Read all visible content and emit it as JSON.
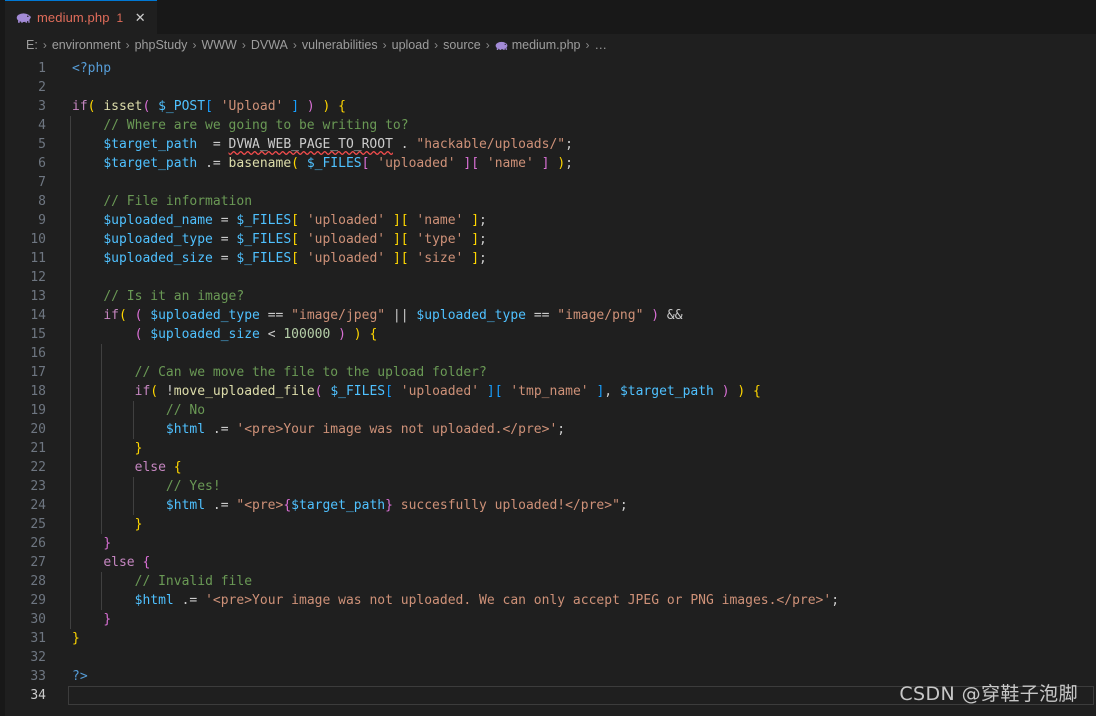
{
  "tab": {
    "filename": "medium.php",
    "badge": "1",
    "close_label": "✕",
    "icon": "php-elephant-icon"
  },
  "breadcrumbs": {
    "separator": "›",
    "overflow": "…",
    "items": [
      {
        "label": "E:"
      },
      {
        "label": "environment"
      },
      {
        "label": "phpStudy"
      },
      {
        "label": "WWW"
      },
      {
        "label": "DVWA"
      },
      {
        "label": "vulnerabilities"
      },
      {
        "label": "upload"
      },
      {
        "label": "source"
      },
      {
        "label": "medium.php",
        "icon": "php-elephant-icon"
      }
    ]
  },
  "editor": {
    "language": "php",
    "active_line": 34,
    "total_lines": 34,
    "line_numbers": [
      1,
      2,
      3,
      4,
      5,
      6,
      7,
      8,
      9,
      10,
      11,
      12,
      13,
      14,
      15,
      16,
      17,
      18,
      19,
      20,
      21,
      22,
      23,
      24,
      25,
      26,
      27,
      28,
      29,
      30,
      31,
      32,
      33,
      34
    ],
    "lines": [
      {
        "n": 1,
        "text": "<?php"
      },
      {
        "n": 2,
        "text": ""
      },
      {
        "n": 3,
        "text": "if( isset( $_POST[ 'Upload' ] ) ) {"
      },
      {
        "n": 4,
        "text": "    // Where are we going to be writing to?"
      },
      {
        "n": 5,
        "text": "    $target_path  = DVWA_WEB_PAGE_TO_ROOT . \"hackable/uploads/\";"
      },
      {
        "n": 6,
        "text": "    $target_path .= basename( $_FILES[ 'uploaded' ][ 'name' ] );"
      },
      {
        "n": 7,
        "text": ""
      },
      {
        "n": 8,
        "text": "    // File information"
      },
      {
        "n": 9,
        "text": "    $uploaded_name = $_FILES[ 'uploaded' ][ 'name' ];"
      },
      {
        "n": 10,
        "text": "    $uploaded_type = $_FILES[ 'uploaded' ][ 'type' ];"
      },
      {
        "n": 11,
        "text": "    $uploaded_size = $_FILES[ 'uploaded' ][ 'size' ];"
      },
      {
        "n": 12,
        "text": ""
      },
      {
        "n": 13,
        "text": "    // Is it an image?"
      },
      {
        "n": 14,
        "text": "    if( ( $uploaded_type == \"image/jpeg\" || $uploaded_type == \"image/png\" ) &&"
      },
      {
        "n": 15,
        "text": "        ( $uploaded_size < 100000 ) ) {"
      },
      {
        "n": 16,
        "text": ""
      },
      {
        "n": 17,
        "text": "        // Can we move the file to the upload folder?"
      },
      {
        "n": 18,
        "text": "        if( !move_uploaded_file( $_FILES[ 'uploaded' ][ 'tmp_name' ], $target_path ) ) {"
      },
      {
        "n": 19,
        "text": "            // No"
      },
      {
        "n": 20,
        "text": "            $html .= '<pre>Your image was not uploaded.</pre>';"
      },
      {
        "n": 21,
        "text": "        }"
      },
      {
        "n": 22,
        "text": "        else {"
      },
      {
        "n": 23,
        "text": "            // Yes!"
      },
      {
        "n": 24,
        "text": "            $html .= \"<pre>{$target_path} succesfully uploaded!</pre>\";"
      },
      {
        "n": 25,
        "text": "        }"
      },
      {
        "n": 26,
        "text": "    }"
      },
      {
        "n": 27,
        "text": "    else {"
      },
      {
        "n": 28,
        "text": "        // Invalid file"
      },
      {
        "n": 29,
        "text": "        $html .= '<pre>Your image was not uploaded. We can only accept JPEG or PNG images.</pre>';"
      },
      {
        "n": 30,
        "text": "    }"
      },
      {
        "n": 31,
        "text": "}"
      },
      {
        "n": 32,
        "text": ""
      },
      {
        "n": 33,
        "text": "?>"
      },
      {
        "n": 34,
        "text": ""
      }
    ],
    "diagnostics": [
      {
        "line": 5,
        "token": "DVWA_WEB_PAGE_TO_ROOT",
        "severity": "error"
      }
    ]
  },
  "watermark": {
    "text": "CSDN @穿鞋子泡脚"
  },
  "colors": {
    "editor_background": "#1f1f1f",
    "tabbar_background": "#181818",
    "active_tab_border": "#0078d4",
    "tab_modified_text": "#e06c5a",
    "keyword": "#c586c0",
    "function": "#dcdcaa",
    "variable": "#4fc1ff",
    "string": "#ce9178",
    "comment": "#6a9955",
    "number": "#b5cea8",
    "tag": "#569cd6",
    "bracket1": "#ffd700",
    "bracket2": "#da70d6",
    "bracket3": "#179fff",
    "error_squiggle": "#f14c4c",
    "line_number": "#6e7681"
  }
}
